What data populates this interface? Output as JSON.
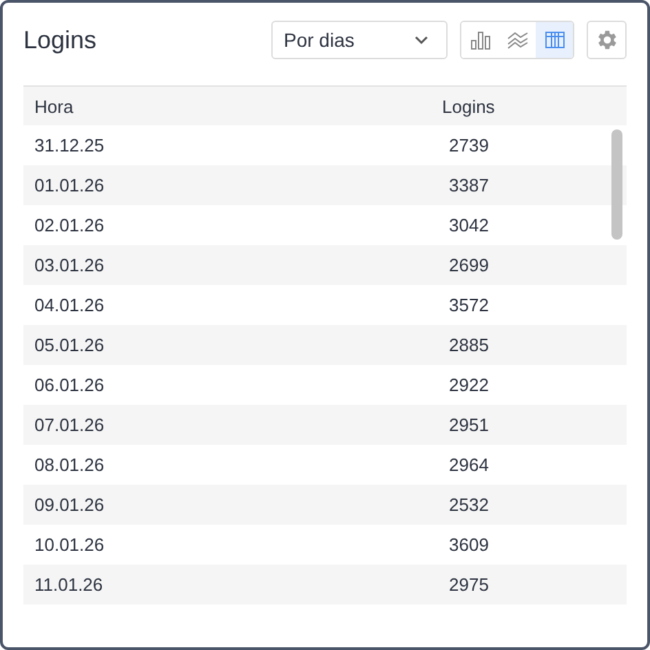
{
  "title": "Logins",
  "period_select": {
    "value": "Por dias"
  },
  "views": [
    {
      "kind": "bar",
      "selected": false
    },
    {
      "kind": "line",
      "selected": false
    },
    {
      "kind": "table",
      "selected": true
    }
  ],
  "table": {
    "columns": [
      "Hora",
      "Logins"
    ],
    "rows": [
      [
        "31.12.25",
        "2739"
      ],
      [
        "01.01.26",
        "3387"
      ],
      [
        "02.01.26",
        "3042"
      ],
      [
        "03.01.26",
        "2699"
      ],
      [
        "04.01.26",
        "3572"
      ],
      [
        "05.01.26",
        "2885"
      ],
      [
        "06.01.26",
        "2922"
      ],
      [
        "07.01.26",
        "2951"
      ],
      [
        "08.01.26",
        "2964"
      ],
      [
        "09.01.26",
        "2532"
      ],
      [
        "10.01.26",
        "3609"
      ],
      [
        "11.01.26",
        "2975"
      ]
    ]
  }
}
